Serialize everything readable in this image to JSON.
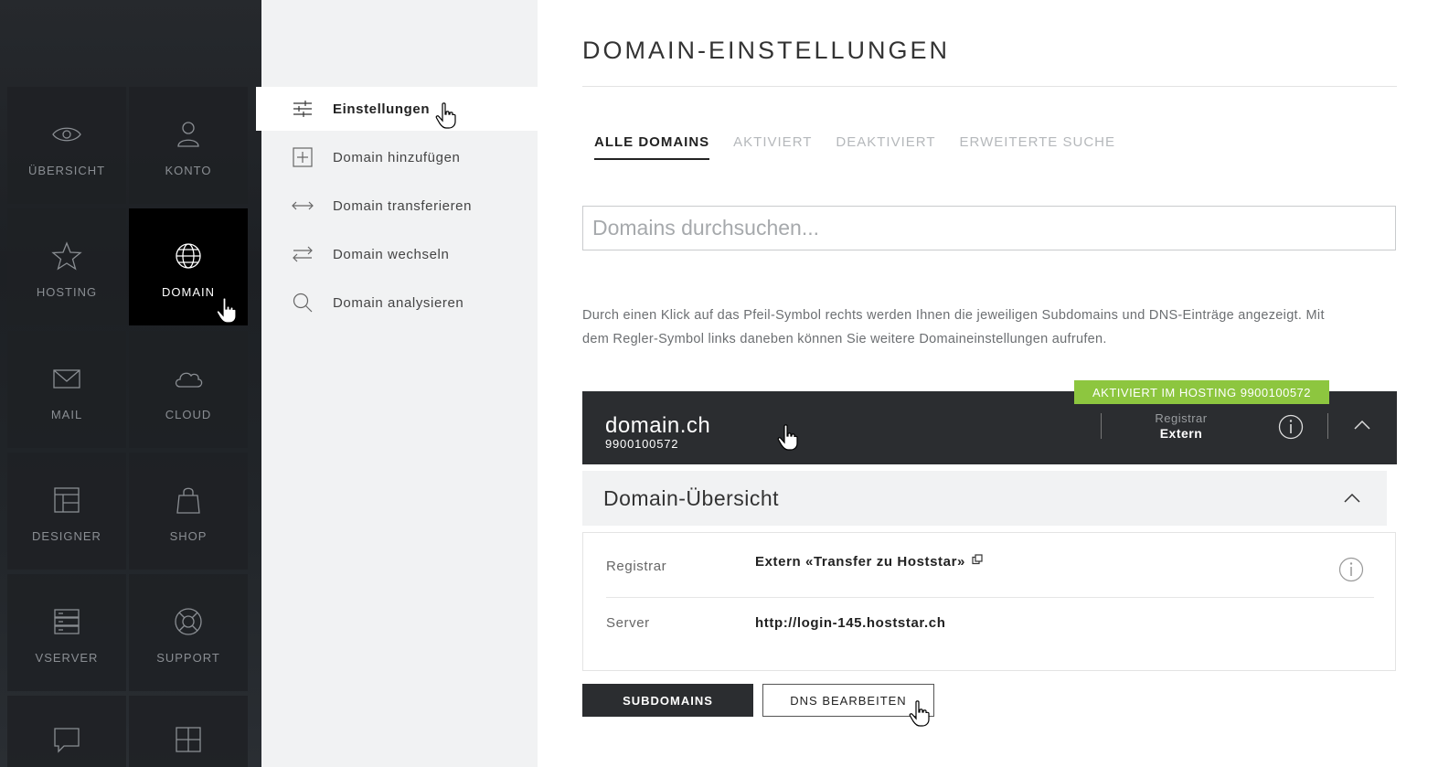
{
  "sidebar": {
    "items": [
      {
        "label": "Übersicht",
        "icon": "eye-icon"
      },
      {
        "label": "Konto",
        "icon": "user-icon"
      },
      {
        "label": "Hosting",
        "icon": "star-icon"
      },
      {
        "label": "Domain",
        "icon": "globe-icon",
        "active": true
      },
      {
        "label": "Mail",
        "icon": "envelope-icon"
      },
      {
        "label": "Cloud",
        "icon": "cloud-icon"
      },
      {
        "label": "Designer",
        "icon": "layout-icon"
      },
      {
        "label": "Shop",
        "icon": "shopping-bag-icon"
      },
      {
        "label": "vServer",
        "icon": "server-icon"
      },
      {
        "label": "Support",
        "icon": "lifebuoy-icon"
      },
      {
        "icon": "chat-icon"
      },
      {
        "icon": "plus-square-icon"
      }
    ]
  },
  "submenu": {
    "items": [
      {
        "label": "Einstellungen",
        "icon": "sliders-icon",
        "active": true
      },
      {
        "label": "Domain hinzufügen",
        "icon": "plus-box-icon"
      },
      {
        "label": "Domain transferieren",
        "icon": "arrows-horizontal-icon"
      },
      {
        "label": "Domain wechseln",
        "icon": "swap-arrows-icon"
      },
      {
        "label": "Domain analysieren",
        "icon": "magnifier-icon"
      }
    ]
  },
  "main": {
    "title": "DOMAIN-EINSTELLUNGEN",
    "tabs": [
      {
        "label": "ALLE DOMAINS",
        "active": true
      },
      {
        "label": "AKTIVIERT"
      },
      {
        "label": "DEAKTIVIERT"
      },
      {
        "label": "ERWEITERTE SUCHE"
      }
    ],
    "search": {
      "placeholder": "Domains durchsuchen...",
      "value": ""
    },
    "hint": "Durch einen Klick auf das Pfeil-Symbol rechts werden Ihnen die jeweiligen Subdomains und DNS-Einträge angezeigt. Mit dem Regler-Symbol links daneben können Sie weitere Domaineinstellungen aufrufen.",
    "domain": {
      "badge": "AKTIVIERT IM HOSTING 9900100572",
      "name": "domain.ch",
      "number": "9900100572",
      "registrar_label": "Registrar",
      "registrar_value": "Extern"
    },
    "overview": {
      "title": "Domain-Übersicht",
      "rows": [
        {
          "label": "Registrar",
          "value": "Extern «Transfer zu Hoststar»"
        },
        {
          "label": "Server",
          "value": "http://login-145.hoststar.ch"
        }
      ]
    },
    "buttons": {
      "subdomains": "SUBDOMAINS",
      "dns": "DNS BEARBEITEN"
    }
  },
  "colors": {
    "accent_green": "#8dc63f",
    "dark_bar": "#2b2d30",
    "sidebar_active": "#000000"
  }
}
